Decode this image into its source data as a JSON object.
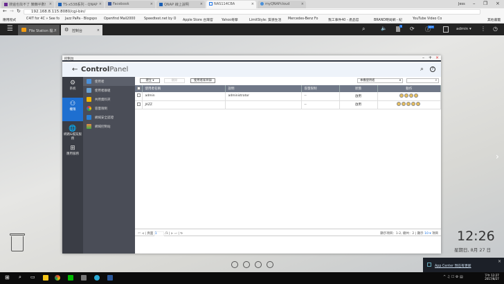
{
  "browser": {
    "tabs": [
      "搜遍也找不了 懶懶半數!",
      "TS-x538系列 - QNAP",
      "Facebook",
      "QNAP 線上說明",
      "NAS114CBA",
      "myQNAPcloud"
    ],
    "user": "Jess",
    "url": "192.168.8.115:8080/cgi-bin/",
    "bookmarks": [
      "應用程式",
      "C4IT for 4C » See fo",
      "Jazz PaPa - Blogspo",
      "Openfind Mail2000",
      "Speedtest.net by O",
      "Apple Store 台灣官",
      "Yahoo奇摩",
      "LimitStyle: 質感生活",
      "Mercedes-Benz Fo",
      "我工事件40 - 產品官",
      "BRAND時尚網 - 紀",
      "YouTube Video Co",
      "其他書籤"
    ]
  },
  "qts": {
    "tabs": [
      "File Station 檔...",
      "控制台"
    ],
    "user": "admin",
    "badge_update": "1",
    "badge_info": "10+"
  },
  "window": {
    "title": "控制台",
    "app_title_bold": "Control",
    "app_title_light": "Panel",
    "nav": [
      "系統",
      "權限",
      "網路&檔案服務",
      "應用服務"
    ],
    "subnav": [
      "使用者",
      "使用者群組",
      "共用資料夾",
      "容量限制",
      "網域安全認證",
      "網域控制站"
    ],
    "toolbar": {
      "create": "建立 ▾",
      "delete": "刪除",
      "home": "使用者家目錄",
      "filter": "本機使用者"
    },
    "columns": [
      "使用者名稱",
      "說明",
      "容量限制",
      "狀態",
      "動作"
    ],
    "rows": [
      {
        "name": "admin",
        "desc": "administrator",
        "quota": "--",
        "status": "啟用"
      },
      {
        "name": "JAZZ",
        "desc": "",
        "quota": "--",
        "status": "啟用"
      }
    ],
    "footer": {
      "page_label": "頁面",
      "page": "1",
      "total": "/1",
      "summary": "顯示項目：1-2, 總共：2",
      "show": "顯示",
      "per_page": "10",
      "items": "項目"
    }
  },
  "desktop": {
    "time": "12:26",
    "date": "星期日, 8月 27 日",
    "notification": "App Center 現在有更新"
  },
  "taskbar": {
    "time": "下午 12:27",
    "date": "2017/8/27"
  }
}
